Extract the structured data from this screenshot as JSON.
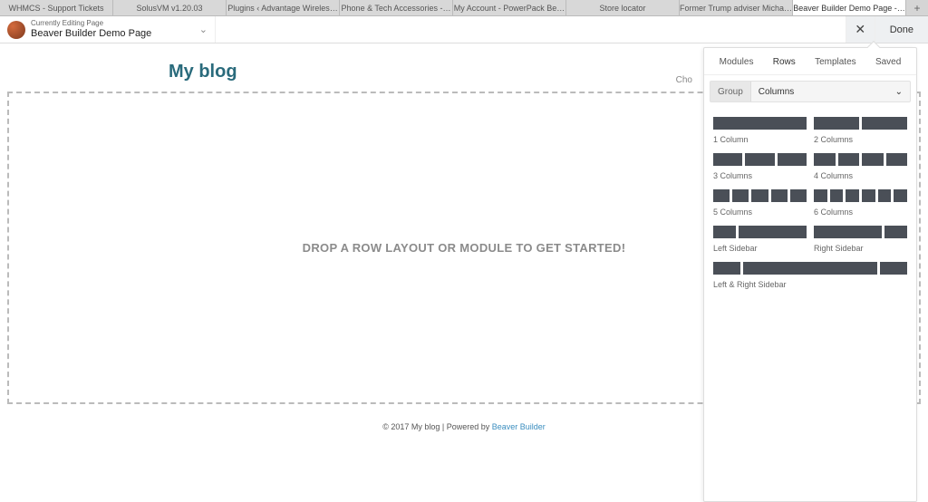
{
  "browser_tabs": [
    "WHMCS - Support Tickets",
    "SolusVM v1.20.03",
    "Plugins ‹ Advantage Wireles…",
    "Phone & Tech Accessories -…",
    "My Account - PowerPack Be…",
    "Store locator",
    "Former Trump adviser Micha…",
    "Beaver Builder Demo Page -…"
  ],
  "toolbar": {
    "editing_label": "Currently Editing Page",
    "page_title": "Beaver Builder Demo Page",
    "done_label": "Done"
  },
  "page": {
    "blog_title": "My blog",
    "choose_hint": "Cho",
    "drop_message": "DROP A ROW LAYOUT OR MODULE TO GET STARTED!",
    "footer_prefix": "© 2017 My blog | Powered by ",
    "footer_link": "Beaver Builder"
  },
  "panel": {
    "tabs": [
      "Modules",
      "Rows",
      "Templates",
      "Saved"
    ],
    "active_tab": 1,
    "group_label": "Group",
    "group_value": "Columns",
    "layouts": [
      {
        "label": "1 Column",
        "cols": [
          1
        ]
      },
      {
        "label": "2 Columns",
        "cols": [
          1,
          1
        ]
      },
      {
        "label": "3 Columns",
        "cols": [
          1,
          1,
          1
        ]
      },
      {
        "label": "4 Columns",
        "cols": [
          1,
          1,
          1,
          1
        ]
      },
      {
        "label": "5 Columns",
        "cols": [
          1,
          1,
          1,
          1,
          1
        ]
      },
      {
        "label": "6 Columns",
        "cols": [
          1,
          1,
          1,
          1,
          1,
          1
        ]
      },
      {
        "label": "Left Sidebar",
        "cols": [
          1,
          3
        ]
      },
      {
        "label": "Right Sidebar",
        "cols": [
          3,
          1
        ]
      },
      {
        "label": "Left & Right Sidebar",
        "cols": [
          1,
          5,
          1
        ],
        "full": true
      }
    ]
  }
}
